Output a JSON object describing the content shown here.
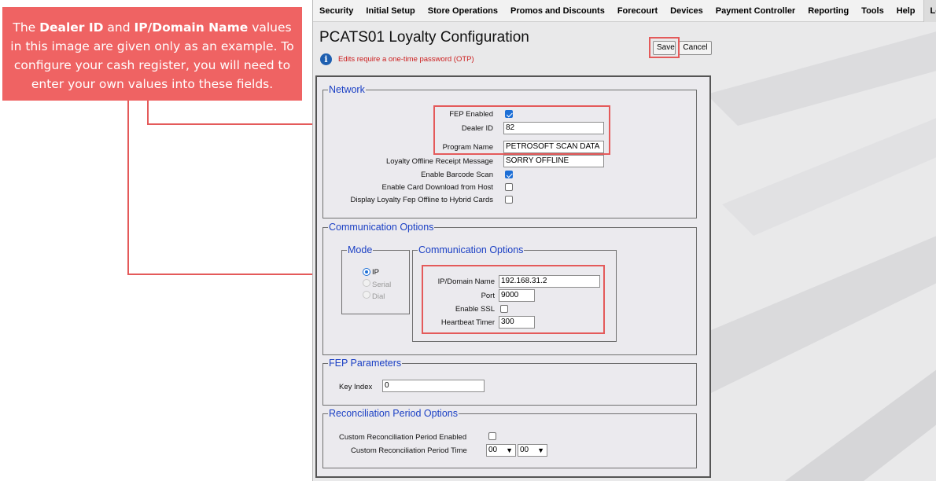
{
  "callout": {
    "t1": "The ",
    "b1": "Dealer ID",
    "t2": " and ",
    "b2": "IP/Domain Name",
    "t3": " values in this image are given only as an example.  To configure your cash register, you will need to enter your own values into these fields."
  },
  "nav": {
    "items": [
      "Security",
      "Initial Setup",
      "Store Operations",
      "Promos and Discounts",
      "Forecourt",
      "Devices",
      "Payment Controller",
      "Reporting",
      "Tools",
      "Help"
    ],
    "logout": "Log Out"
  },
  "page": {
    "title": "PCATS01 Loyalty Configuration",
    "otp_notice": "Edits require a one-time password (OTP)",
    "save": "Save",
    "cancel": "Cancel"
  },
  "network": {
    "legend": "Network",
    "fep_enabled_label": "FEP Enabled",
    "fep_enabled": true,
    "dealer_id_label": "Dealer ID",
    "dealer_id": "82",
    "program_name_label": "Program Name",
    "program_name": "PETROSOFT SCAN DATA",
    "offline_msg_label": "Loyalty Offline Receipt Message",
    "offline_msg": "SORRY OFFLINE",
    "barcode_label": "Enable Barcode Scan",
    "barcode": true,
    "card_download_label": "Enable Card Download from Host",
    "card_download": false,
    "display_offline_label": "Display Loyalty Fep Offline to Hybrid Cards",
    "display_offline": false
  },
  "comm": {
    "legend": "Communication Options",
    "mode_legend": "Mode",
    "mode_options": [
      "IP",
      "Serial",
      "Dial"
    ],
    "mode_selected": "IP",
    "inner_legend": "Communication Options",
    "ip_label": "IP/Domain Name",
    "ip": "192.168.31.2",
    "port_label": "Port",
    "port": "9000",
    "ssl_label": "Enable SSL",
    "ssl": false,
    "heartbeat_label": "Heartbeat Timer",
    "heartbeat": "300"
  },
  "fep": {
    "legend": "FEP Parameters",
    "key_index_label": "Key Index",
    "key_index": "0"
  },
  "recon": {
    "legend": "Reconciliation Period Options",
    "custom_enabled_label": "Custom Reconciliation Period Enabled",
    "custom_enabled": false,
    "custom_time_label": "Custom Reconciliation Period Time",
    "hour": "00",
    "minute": "00"
  },
  "colors": {
    "callout": "#ef6363",
    "legend": "#1a3fc4",
    "otp_text": "#cc1d1d",
    "info_icon": "#1e5fb0"
  }
}
